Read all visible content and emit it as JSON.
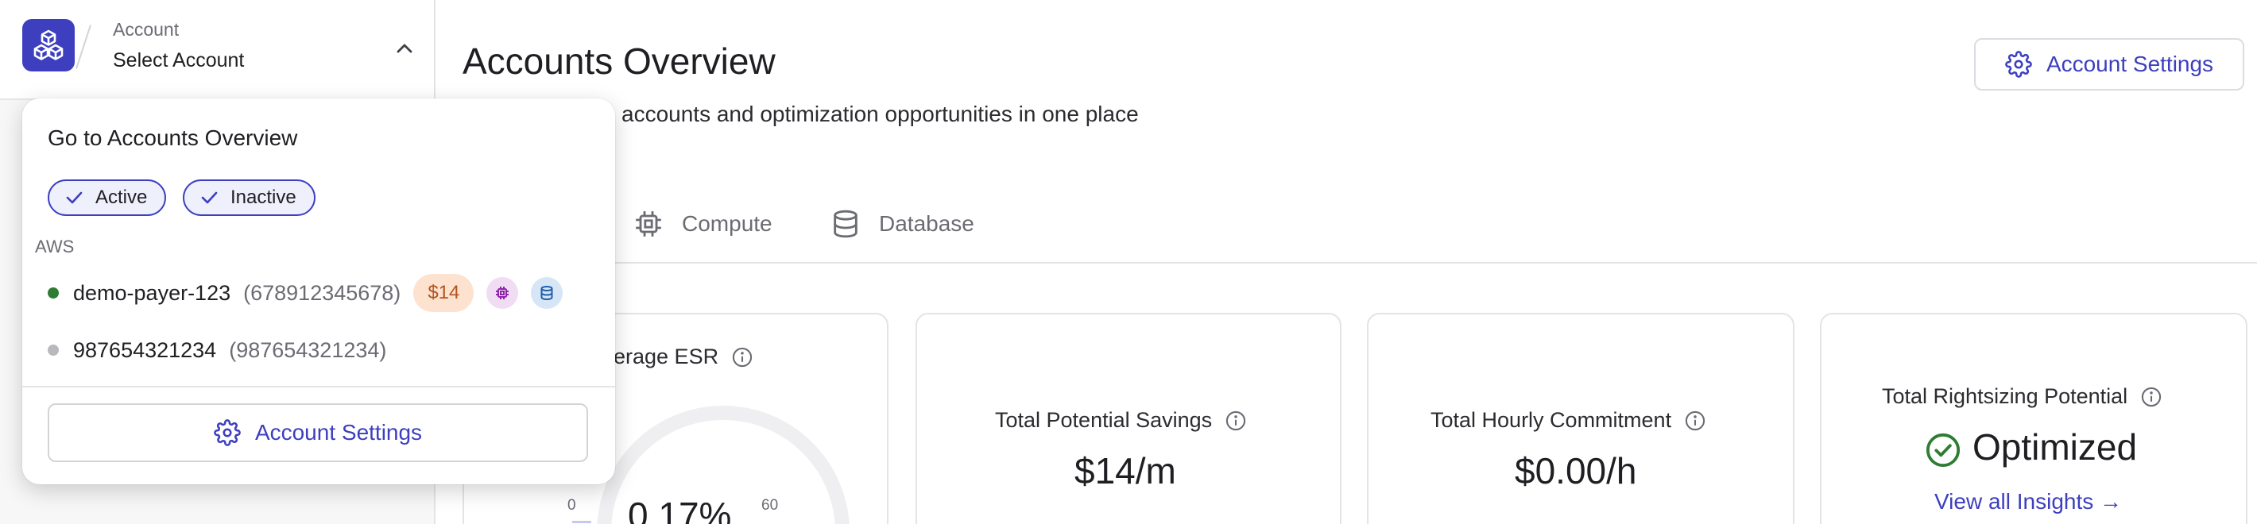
{
  "sidebar": {
    "account_label": "Account",
    "account_value": "Select Account"
  },
  "dropdown": {
    "title": "Go to Accounts Overview",
    "filters": [
      {
        "label": "Active",
        "selected": true
      },
      {
        "label": "Inactive",
        "selected": true
      }
    ],
    "section": "AWS",
    "accounts": [
      {
        "name": "demo-payer-123",
        "id": "(678912345678)",
        "status": "active",
        "status_color": "#2e7d32",
        "cost": "$14",
        "icons": [
          "compute-icon",
          "database-icon"
        ]
      },
      {
        "name": "987654321234",
        "id": "(987654321234)",
        "status": "inactive",
        "status_color": "#b8b8bd"
      }
    ],
    "settings_label": "Account Settings"
  },
  "header": {
    "title": "Accounts Overview",
    "subtitle_visible": "accounts and optimization opportunities in one place",
    "settings_label": "Account Settings"
  },
  "tabs": [
    {
      "label": "Compute",
      "icon": "chip-icon"
    },
    {
      "label": "Database",
      "icon": "database-icon"
    }
  ],
  "cards": {
    "esr": {
      "label": "erage ESR",
      "value": "0.17%",
      "gauge_value": 0.17,
      "gauge_min": "0",
      "gauge_max": "60"
    },
    "savings": {
      "label": "Total Potential Savings",
      "value": "$14/m"
    },
    "commitment": {
      "label": "Total Hourly Commitment",
      "value": "$0.00/h"
    },
    "rightsizing": {
      "label": "Total Rightsizing Potential",
      "value": "Optimized",
      "link": "View all Insights →"
    }
  },
  "colors": {
    "accent": "#3d3fbf",
    "success": "#2e7d32",
    "cost_bg": "#fde3cf",
    "cost_text": "#b4531f"
  }
}
